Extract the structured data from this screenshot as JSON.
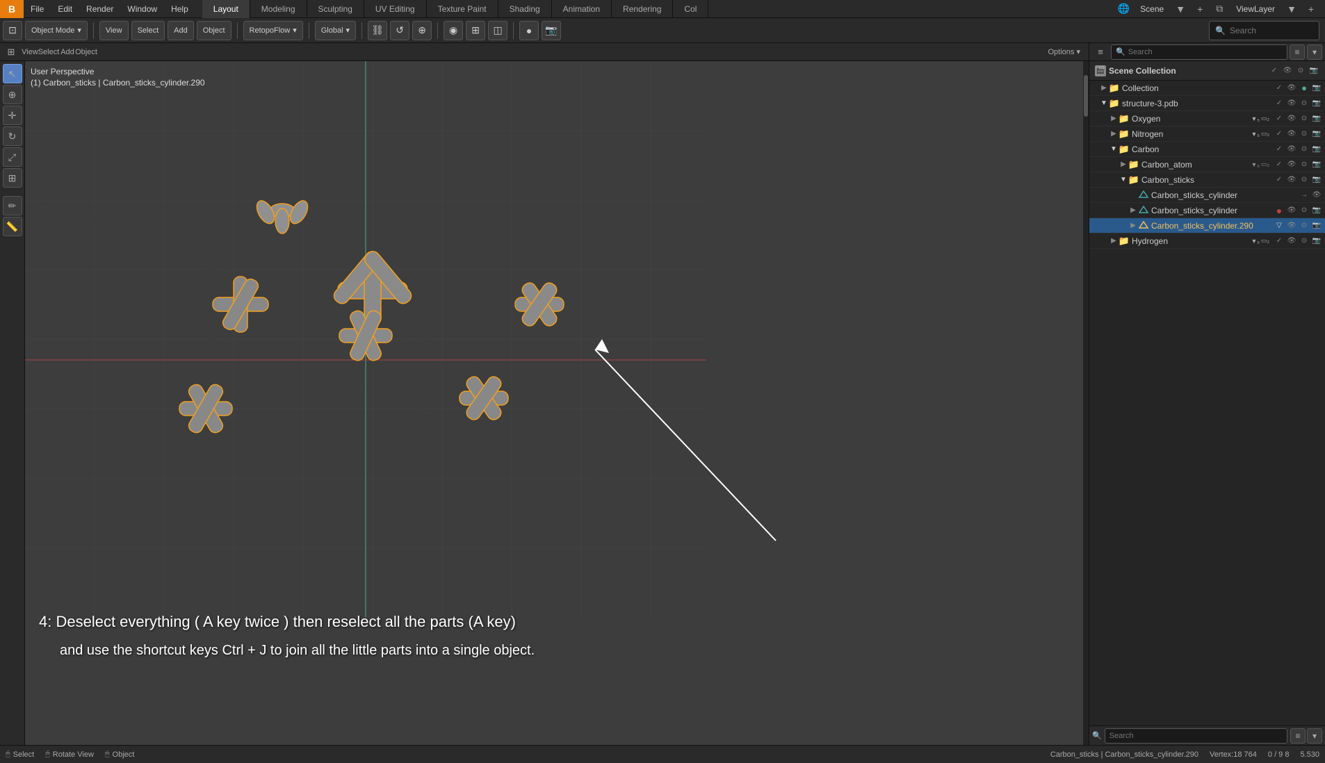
{
  "app": {
    "title": "Blender",
    "logo": "B"
  },
  "top_menu": {
    "items": [
      "File",
      "Edit",
      "Render",
      "Window",
      "Help"
    ],
    "workspaces": [
      "Layout",
      "Modeling",
      "Sculpting",
      "UV Editing",
      "Texture Paint",
      "Shading",
      "Animation",
      "Rendering",
      "Col"
    ],
    "active_workspace": "Layout",
    "scene_label": "Scene",
    "viewlayer_label": "ViewLayer"
  },
  "toolbar": {
    "mode_btn": "Object Mode",
    "view_btn": "View",
    "select_btn": "Select",
    "add_btn": "Add",
    "object_btn": "Object",
    "retopoflow_btn": "RetopoFlow",
    "global_btn": "Global",
    "search_placeholder": "Search",
    "options_btn": "Options"
  },
  "viewport": {
    "perspective_text": "User Perspective",
    "object_info": "(1) Carbon_sticks | Carbon_sticks_cylinder.290",
    "overlay_line1": "4: Deselect everything ( A key twice ) then reselect all the parts (A key)",
    "overlay_line2": "and use the shortcut keys Ctrl + J to join all the little parts into a single object."
  },
  "outliner": {
    "header_search_placeholder": "Search",
    "scene_collection": "Scene Collection",
    "items": [
      {
        "id": "collection",
        "label": "Collection",
        "indent": 1,
        "type": "collection",
        "expanded": false,
        "depth": 1
      },
      {
        "id": "structure3pdb",
        "label": "structure-3.pdb",
        "indent": 1,
        "type": "collection",
        "expanded": true,
        "depth": 1
      },
      {
        "id": "oxygen",
        "label": "Oxygen",
        "indent": 2,
        "type": "collection",
        "expanded": false,
        "depth": 2
      },
      {
        "id": "nitrogen",
        "label": "Nitrogen",
        "indent": 2,
        "type": "collection",
        "expanded": false,
        "depth": 2
      },
      {
        "id": "carbon",
        "label": "Carbon",
        "indent": 2,
        "type": "collection",
        "expanded": true,
        "depth": 2
      },
      {
        "id": "carbon_atom",
        "label": "Carbon_atom",
        "indent": 3,
        "type": "collection",
        "expanded": false,
        "depth": 3
      },
      {
        "id": "carbon_sticks",
        "label": "Carbon_sticks",
        "indent": 3,
        "type": "collection",
        "expanded": true,
        "depth": 3
      },
      {
        "id": "carbon_sticks_cylinder",
        "label": "Carbon_sticks_cylinder",
        "indent": 4,
        "type": "object",
        "expanded": false,
        "depth": 4
      },
      {
        "id": "carbon_sticks_cylinder2",
        "label": "Carbon_sticks_cylinder",
        "indent": 4,
        "type": "object",
        "expanded": false,
        "depth": 4
      },
      {
        "id": "carbon_sticks_cylinder290",
        "label": "Carbon_sticks_cylinder.290",
        "indent": 4,
        "type": "object_active",
        "expanded": false,
        "depth": 4
      },
      {
        "id": "hydrogen",
        "label": "Hydrogen",
        "indent": 2,
        "type": "collection",
        "expanded": false,
        "depth": 2
      }
    ],
    "bottom_search_placeholder": "Search"
  },
  "status_bar": {
    "select": "Select",
    "rotate_view": "Rotate View",
    "object_label": "Object",
    "info_text": "Carbon_sticks | Carbon_sticks_cylinder.290",
    "vertex_info": "Vertex:18 764",
    "num_info": "0 / 9 8",
    "coord_info": "5.530"
  },
  "icons": {
    "search": "🔍",
    "expand_right": "▶",
    "expand_down": "▼",
    "collection": "📁",
    "mesh": "⬡",
    "object": "○",
    "eye": "👁",
    "camera": "📷",
    "check": "✓",
    "filter": "≡",
    "chevron_down": "▾"
  },
  "colors": {
    "active_workspace": "#3a3a3a",
    "accent_blue": "#5680c2",
    "selected_row": "#1a3a5c",
    "active_row": "#2a5a8c",
    "highlight_yellow": "#f0c060",
    "collection_icon": "#c05050",
    "mesh_icon": "#4a9a9a",
    "orange": "#e87d0d"
  }
}
